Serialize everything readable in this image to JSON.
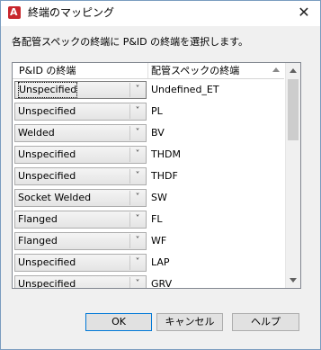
{
  "window": {
    "title": "終端のマッピング",
    "app_icon": "autocad-a-icon",
    "app_icon_glyph": "A",
    "close_glyph": "✕"
  },
  "instruction": "各配管スペックの終端に P&ID の終端を選択します。",
  "grid": {
    "columns": [
      "P&ID の終端",
      "配管スペックの終端"
    ],
    "sort_indicator": "ascending",
    "rows": [
      {
        "pid_end": "Unspecified",
        "spec_end": "Undefined_ET"
      },
      {
        "pid_end": "Unspecified",
        "spec_end": "PL"
      },
      {
        "pid_end": "Welded",
        "spec_end": "BV"
      },
      {
        "pid_end": "Unspecified",
        "spec_end": "THDM"
      },
      {
        "pid_end": "Unspecified",
        "spec_end": "THDF"
      },
      {
        "pid_end": "Socket Welded",
        "spec_end": "SW"
      },
      {
        "pid_end": "Flanged",
        "spec_end": "FL"
      },
      {
        "pid_end": "Flanged",
        "spec_end": "WF"
      },
      {
        "pid_end": "Unspecified",
        "spec_end": "LAP"
      },
      {
        "pid_end": "Unspecified",
        "spec_end": "GRV"
      }
    ]
  },
  "buttons": {
    "ok": "OK",
    "cancel": "キャンセル",
    "help": "ヘルプ"
  },
  "colors": {
    "accent": "#0078d7",
    "app_icon_bg": "#c8262c"
  }
}
